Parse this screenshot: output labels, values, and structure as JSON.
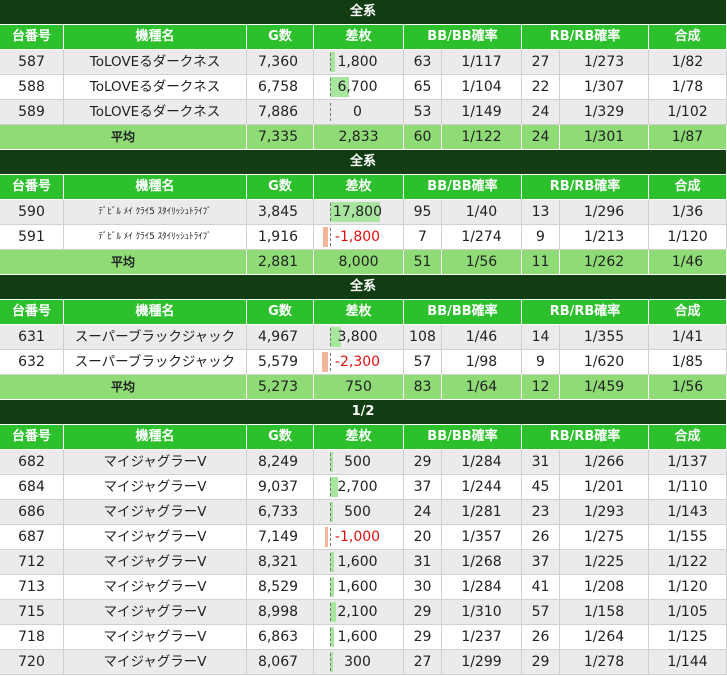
{
  "columns": [
    "台番号",
    "機種名",
    "G数",
    "差枚",
    "BB/BB確率",
    "RB/RB確率",
    "合成"
  ],
  "colors": {
    "group_bg": "#123d12",
    "header_bg": "#2cc02c",
    "avg_bg": "#8fdb75",
    "pos_bar": "#a8e6a0",
    "neg_bar": "#f2b69a",
    "negative_text": "#e01010"
  },
  "diff_scale_max": 17800,
  "sections": [
    {
      "title": "全系",
      "rows": [
        {
          "no": "587",
          "model": "ToLOVEるダークネス",
          "games": "7,360",
          "diff": "1,800",
          "diff_value": 1800,
          "bb": "63",
          "bb_rate": "1/117",
          "rb": "27",
          "rb_rate": "1/273",
          "combined": "1/82"
        },
        {
          "no": "588",
          "model": "ToLOVEるダークネス",
          "games": "6,758",
          "diff": "6,700",
          "diff_value": 6700,
          "bb": "65",
          "bb_rate": "1/104",
          "rb": "22",
          "rb_rate": "1/307",
          "combined": "1/78"
        },
        {
          "no": "589",
          "model": "ToLOVEるダークネス",
          "games": "7,886",
          "diff": "0",
          "diff_value": 0,
          "bb": "53",
          "bb_rate": "1/149",
          "rb": "24",
          "rb_rate": "1/329",
          "combined": "1/102"
        }
      ],
      "avg": {
        "label": "平均",
        "games": "7,335",
        "diff": "2,833",
        "bb": "60",
        "bb_rate": "1/122",
        "rb": "24",
        "rb_rate": "1/301",
        "combined": "1/87"
      }
    },
    {
      "title": "全系",
      "small_model": true,
      "rows": [
        {
          "no": "590",
          "model": "ﾃﾞﾋﾞﾙ ﾒｲ ｸﾗｲ5 ｽﾀｲﾘｯｼｭﾄﾗｲﾌﾞ",
          "games": "3,845",
          "diff": "17,800",
          "diff_value": 17800,
          "bb": "95",
          "bb_rate": "1/40",
          "rb": "13",
          "rb_rate": "1/296",
          "combined": "1/36"
        },
        {
          "no": "591",
          "model": "ﾃﾞﾋﾞﾙ ﾒｲ ｸﾗｲ5 ｽﾀｲﾘｯｼｭﾄﾗｲﾌﾞ",
          "games": "1,916",
          "diff": "-1,800",
          "diff_value": -1800,
          "bb": "7",
          "bb_rate": "1/274",
          "rb": "9",
          "rb_rate": "1/213",
          "combined": "1/120"
        }
      ],
      "avg": {
        "label": "平均",
        "games": "2,881",
        "diff": "8,000",
        "bb": "51",
        "bb_rate": "1/56",
        "rb": "11",
        "rb_rate": "1/262",
        "combined": "1/46"
      }
    },
    {
      "title": "全系",
      "rows": [
        {
          "no": "631",
          "model": "スーパーブラックジャック",
          "games": "4,967",
          "diff": "3,800",
          "diff_value": 3800,
          "bb": "108",
          "bb_rate": "1/46",
          "rb": "14",
          "rb_rate": "1/355",
          "combined": "1/41"
        },
        {
          "no": "632",
          "model": "スーパーブラックジャック",
          "games": "5,579",
          "diff": "-2,300",
          "diff_value": -2300,
          "bb": "57",
          "bb_rate": "1/98",
          "rb": "9",
          "rb_rate": "1/620",
          "combined": "1/85"
        }
      ],
      "avg": {
        "label": "平均",
        "games": "5,273",
        "diff": "750",
        "bb": "83",
        "bb_rate": "1/64",
        "rb": "12",
        "rb_rate": "1/459",
        "combined": "1/56"
      }
    },
    {
      "title": "1/2",
      "rows": [
        {
          "no": "682",
          "model": "マイジャグラーV",
          "games": "8,249",
          "diff": "500",
          "diff_value": 500,
          "bb": "29",
          "bb_rate": "1/284",
          "rb": "31",
          "rb_rate": "1/266",
          "combined": "1/137"
        },
        {
          "no": "684",
          "model": "マイジャグラーV",
          "games": "9,037",
          "diff": "2,700",
          "diff_value": 2700,
          "bb": "37",
          "bb_rate": "1/244",
          "rb": "45",
          "rb_rate": "1/201",
          "combined": "1/110"
        },
        {
          "no": "686",
          "model": "マイジャグラーV",
          "games": "6,733",
          "diff": "500",
          "diff_value": 500,
          "bb": "24",
          "bb_rate": "1/281",
          "rb": "23",
          "rb_rate": "1/293",
          "combined": "1/143"
        },
        {
          "no": "687",
          "model": "マイジャグラーV",
          "games": "7,149",
          "diff": "-1,000",
          "diff_value": -1000,
          "bb": "20",
          "bb_rate": "1/357",
          "rb": "26",
          "rb_rate": "1/275",
          "combined": "1/155"
        },
        {
          "no": "712",
          "model": "マイジャグラーV",
          "games": "8,321",
          "diff": "1,600",
          "diff_value": 1600,
          "bb": "31",
          "bb_rate": "1/268",
          "rb": "37",
          "rb_rate": "1/225",
          "combined": "1/122"
        },
        {
          "no": "713",
          "model": "マイジャグラーV",
          "games": "8,529",
          "diff": "1,600",
          "diff_value": 1600,
          "bb": "30",
          "bb_rate": "1/284",
          "rb": "41",
          "rb_rate": "1/208",
          "combined": "1/120"
        },
        {
          "no": "715",
          "model": "マイジャグラーV",
          "games": "8,998",
          "diff": "2,100",
          "diff_value": 2100,
          "bb": "29",
          "bb_rate": "1/310",
          "rb": "57",
          "rb_rate": "1/158",
          "combined": "1/105"
        },
        {
          "no": "718",
          "model": "マイジャグラーV",
          "games": "6,863",
          "diff": "1,600",
          "diff_value": 1600,
          "bb": "29",
          "bb_rate": "1/237",
          "rb": "26",
          "rb_rate": "1/264",
          "combined": "1/125"
        },
        {
          "no": "720",
          "model": "マイジャグラーV",
          "games": "8,067",
          "diff": "300",
          "diff_value": 300,
          "bb": "27",
          "bb_rate": "1/299",
          "rb": "29",
          "rb_rate": "1/278",
          "combined": "1/144"
        }
      ]
    }
  ]
}
